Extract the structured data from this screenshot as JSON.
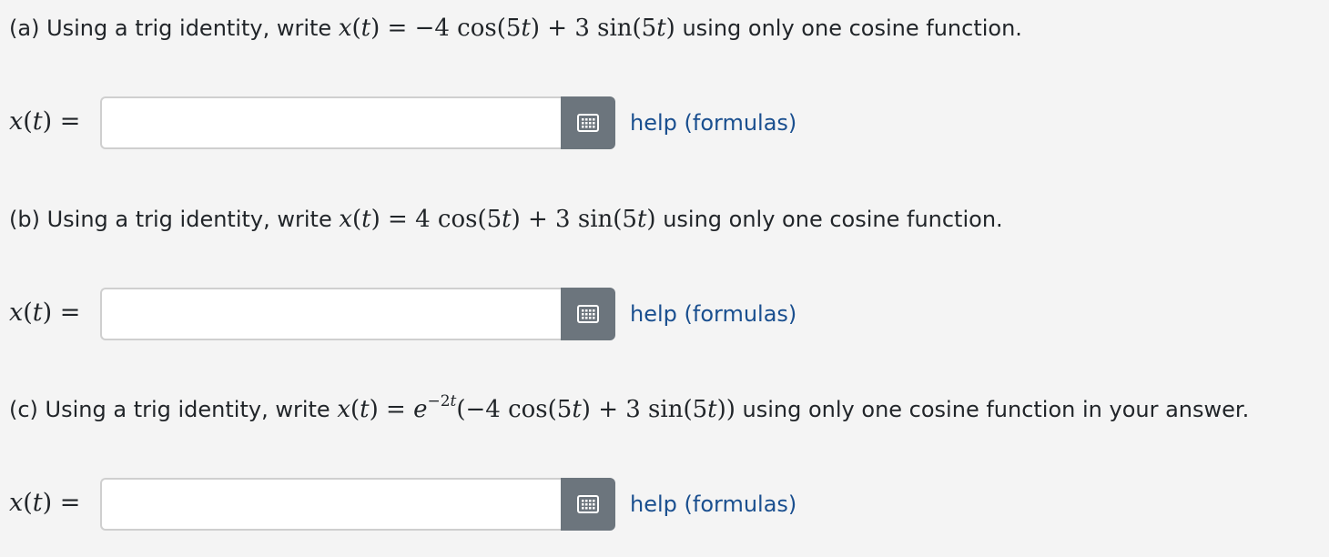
{
  "parts": [
    {
      "prefix": "(a) Using a trig identity, write ",
      "equation": "x(t) = −4 cos(5t) + 3 sin(5t)",
      "suffix": " using only one cosine function.",
      "answer_label": "x(t) =",
      "answer_value": "",
      "help_label": "help (formulas)"
    },
    {
      "prefix": "(b) Using a trig identity, write ",
      "equation": "x(t) = 4 cos(5t) + 3 sin(5t)",
      "suffix": " using only one cosine function.",
      "answer_label": "x(t) =",
      "answer_value": "",
      "help_label": "help (formulas)"
    },
    {
      "prefix": "(c) Using a trig identity, write ",
      "equation": "x(t) = e^{−2t}(−4 cos(5t) + 3 sin(5t))",
      "suffix": " using only one cosine function in your answer.",
      "answer_label": "x(t) =",
      "answer_value": "",
      "help_label": "help (formulas)"
    }
  ],
  "icons": {
    "palette": "keypad-grid-icon"
  },
  "colors": {
    "background": "#f4f4f4",
    "text": "#212529",
    "link": "#1a4f8f",
    "button": "#6c757d",
    "input_border": "#cfcfcf"
  }
}
